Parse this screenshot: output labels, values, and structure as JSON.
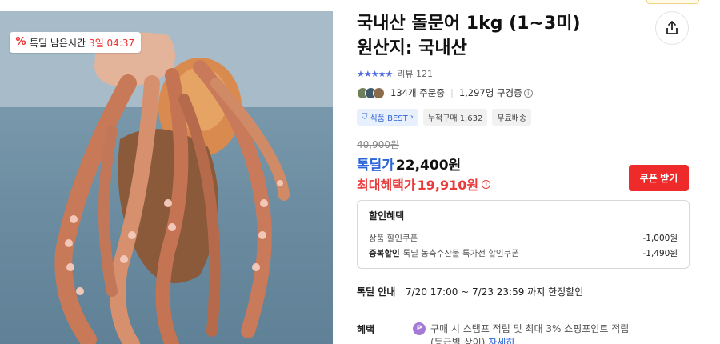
{
  "deal_badge": {
    "label": "톡딜 남은시간",
    "time": "3일 04:37",
    "percent_icon": "%"
  },
  "product": {
    "title_line1": "국내산 돌문어 1kg (1~3미)",
    "title_line2": "원산지: 국내산",
    "rating_stars": "★★★★★",
    "review_label": "리뷰 121",
    "orders": "134개 주문중",
    "viewers": "1,297명 구경중",
    "tags": [
      "식품 BEST",
      "누적구매 1,632",
      "무료배송"
    ],
    "original_price": "40,900원",
    "deal_label": "톡딜가",
    "deal_price": "22,400원",
    "max_label": "최대혜택가",
    "max_price": "19,910원",
    "coupon_button": "쿠폰 받기"
  },
  "discount": {
    "title": "할인혜택",
    "rows": [
      {
        "bold": "",
        "label": "상품 할인쿠폰",
        "amount": "-1,000원"
      },
      {
        "bold": "중복할인",
        "label": "톡딜 농축수산물 특가전 할인쿠폰",
        "amount": "-1,490원"
      }
    ]
  },
  "deal_info": {
    "label": "톡딜 안내",
    "value": "7/20 17:00 ~ 7/23 23:59 까지 한정할인"
  },
  "benefit": {
    "label": "혜택",
    "icon": "P",
    "line1": "구매 시 스탬프 적립 및 최대 3% 쇼핑포인트 적립",
    "line2_prefix": "(등급별 상이)",
    "detail_link": "자세히"
  },
  "colors": {
    "accent_red": "#ef2a2a",
    "accent_blue": "#2b64d8",
    "star_blue": "#4f6bdd"
  },
  "icons": [
    "share-icon",
    "percent-icon",
    "info-icon",
    "shield-icon",
    "point-icon"
  ]
}
